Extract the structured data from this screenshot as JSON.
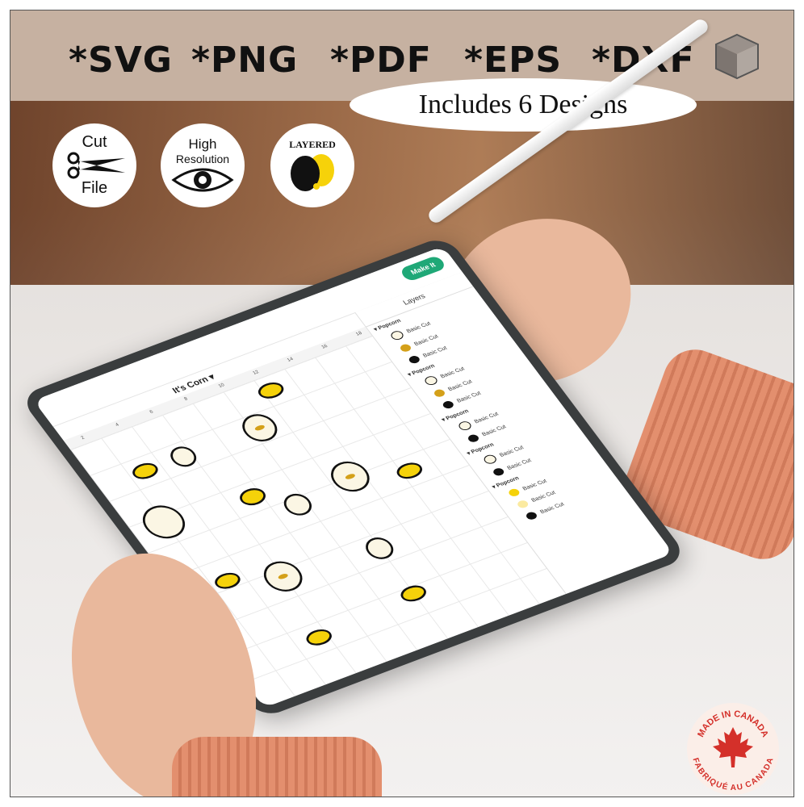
{
  "header": {
    "formats": [
      "*SVG",
      "*PNG",
      "*PDF",
      "*EPS",
      "*DXF"
    ],
    "box_icon": "cube-icon",
    "includes_label": "Includes 6 Designs"
  },
  "badges": {
    "cut_file": {
      "line1": "Cut",
      "line2": "File",
      "icon": "scissors-icon"
    },
    "high_res": {
      "line1": "High",
      "line2": "Resolution",
      "icon": "eye-icon"
    },
    "layered": {
      "label": "LAYERED",
      "icon": "layers-blob-icon"
    }
  },
  "tablet": {
    "make_it_label": "Make It",
    "project_title": "It's Corn ▾",
    "ruler_ticks": [
      "2",
      "4",
      "6",
      "8",
      "10",
      "12",
      "14",
      "16",
      "18"
    ],
    "layers_title": "Layers",
    "layer_groups": [
      {
        "name": "▾ Popcorn",
        "items": [
          "Basic Cut",
          "Basic Cut",
          "Basic Cut"
        ]
      },
      {
        "name": "▾ Popcorn",
        "items": [
          "Basic Cut",
          "Basic Cut",
          "Basic Cut"
        ]
      },
      {
        "name": "▾ Popcorn",
        "items": [
          "Basic Cut",
          "Basic Cut"
        ]
      },
      {
        "name": "▾ Popcorn",
        "items": [
          "Basic Cut",
          "Basic Cut"
        ]
      },
      {
        "name": "▾ Popcorn",
        "items": [
          "Basic Cut",
          "Basic Cut",
          "Basic Cut"
        ]
      }
    ],
    "accent": "#1fa877"
  },
  "seal": {
    "top": "MADE IN CANADA",
    "bottom": "FABRIQUÉ AU CANADA",
    "icon": "maple-leaf-icon"
  },
  "colors": {
    "header_band": "#c6b1a1",
    "kernel_yellow": "#f5d20a",
    "popcorn_cream": "#fbf6e4"
  }
}
